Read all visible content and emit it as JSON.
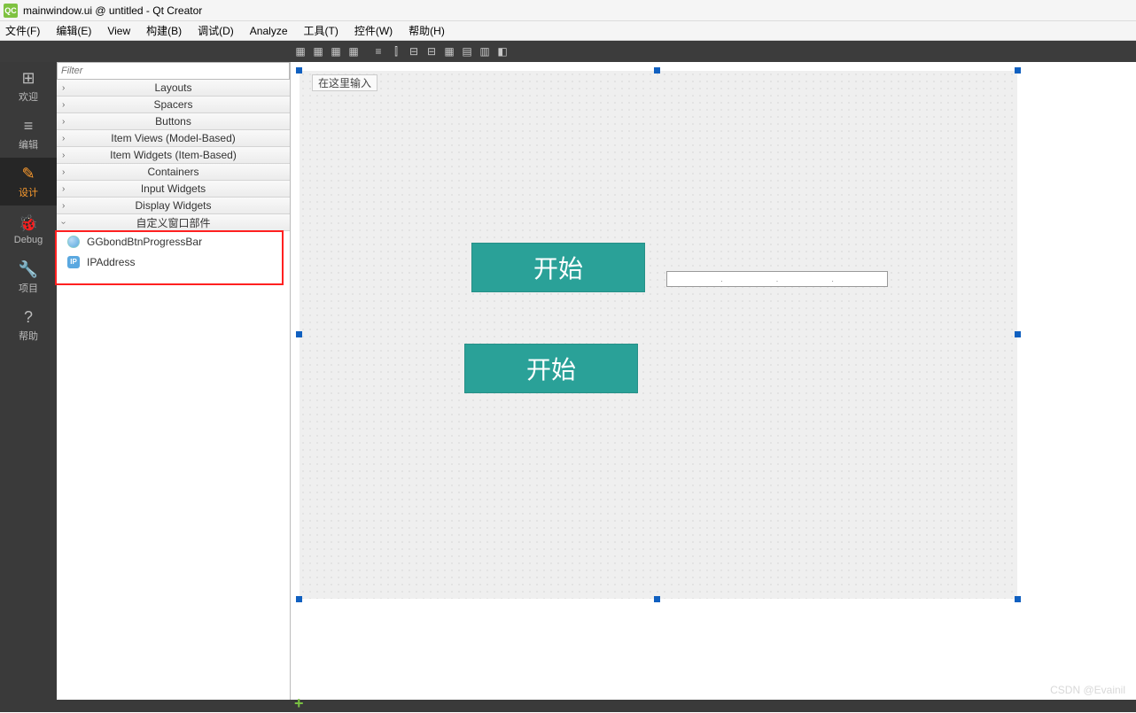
{
  "title": "mainwindow.ui @ untitled - Qt Creator",
  "menu": {
    "file": "文件(F)",
    "edit": "编辑(E)",
    "view": "View",
    "build": "构建(B)",
    "debug": "调试(D)",
    "analyze": "Analyze",
    "tools": "工具(T)",
    "widgets": "控件(W)",
    "help": "帮助(H)"
  },
  "open_file": "mainwindow.ui",
  "leftbar": [
    {
      "label": "欢迎",
      "icon": "⊞"
    },
    {
      "label": "编辑",
      "icon": "≡"
    },
    {
      "label": "设计",
      "icon": "✎",
      "active": true
    },
    {
      "label": "Debug",
      "icon": "🐞"
    },
    {
      "label": "项目",
      "icon": "🔧"
    },
    {
      "label": "帮助",
      "icon": "?"
    }
  ],
  "filter_placeholder": "Filter",
  "categories": [
    "Layouts",
    "Spacers",
    "Buttons",
    "Item Views (Model-Based)",
    "Item Widgets (Item-Based)",
    "Containers",
    "Input Widgets",
    "Display Widgets"
  ],
  "custom_category": "自定义窗口部件",
  "custom_items": [
    {
      "name": "GGbondBtnProgressBar",
      "icon": "blue"
    },
    {
      "name": "IPAddress",
      "icon": "ip",
      "badge": "IP"
    }
  ],
  "canvas": {
    "menu_prompt": "在这里输入",
    "button1": "开始",
    "button2": "开始",
    "ip_dots": ". . ."
  },
  "watermark": "CSDN @Evainil"
}
